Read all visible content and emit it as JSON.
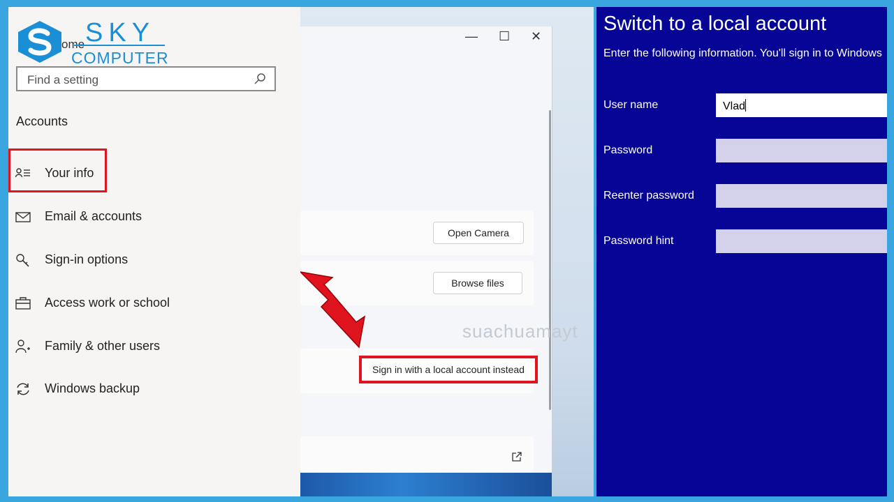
{
  "logo": {
    "line1": "SKY",
    "line2": "COMPUTER"
  },
  "settings": {
    "home_fragment": "ome",
    "search_placeholder": "Find a setting",
    "section_title": "Accounts",
    "items": [
      {
        "label": "Your info",
        "icon": "person-list-icon"
      },
      {
        "label": "Email & accounts",
        "icon": "envelope-icon"
      },
      {
        "label": "Sign-in options",
        "icon": "key-icon"
      },
      {
        "label": "Access work or school",
        "icon": "briefcase-icon"
      },
      {
        "label": "Family & other users",
        "icon": "person-add-icon"
      },
      {
        "label": "Windows backup",
        "icon": "sync-icon"
      }
    ]
  },
  "window": {
    "minimize": "—",
    "maximize": "☐",
    "close": "✕",
    "open_camera": "Open Camera",
    "browse_files": "Browse files",
    "local_account": "Sign in with a local account instead",
    "watermark": "suachuamayt"
  },
  "local_account": {
    "title": "Switch to a local account",
    "subtitle": "Enter the following information. You'll sign in to Windows",
    "user_name_label": "User name",
    "user_name_value": "Vlad",
    "password_label": "Password",
    "reenter_label": "Reenter password",
    "hint_label": "Password hint"
  },
  "colors": {
    "frame": "#3aa6e0",
    "highlight": "#e0141e",
    "dialog_bg": "#060596",
    "brand": "#1a8fd6"
  }
}
